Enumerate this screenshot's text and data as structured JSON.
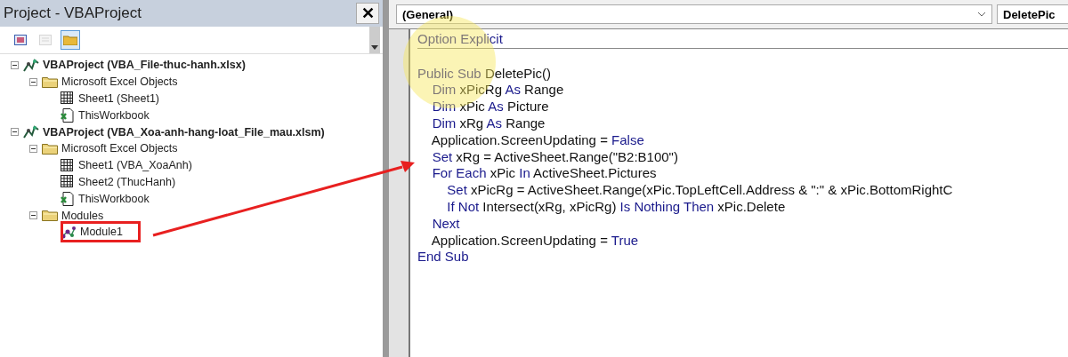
{
  "project_pane": {
    "title": "Project - VBAProject",
    "close": "✕",
    "toolbar": [
      {
        "kind": "view-object",
        "selected": false
      },
      {
        "kind": "view-code",
        "selected": false,
        "disabled": true
      },
      {
        "kind": "toggle-folders",
        "selected": true,
        "disabled": false
      }
    ],
    "tree": [
      {
        "label": "VBAProject (VBA_File-thuc-hanh.xlsx)",
        "kind": "project",
        "expanded": true,
        "highlighted": false,
        "children": [
          {
            "label": "Microsoft Excel Objects",
            "kind": "folder",
            "expanded": true,
            "highlighted": false,
            "children": [
              {
                "label": "Sheet1 (Sheet1)",
                "kind": "sheet",
                "highlighted": false
              },
              {
                "label": "ThisWorkbook",
                "kind": "workbook",
                "highlighted": false
              }
            ]
          }
        ]
      },
      {
        "label": "VBAProject (VBA_Xoa-anh-hang-loat_File_mau.xlsm)",
        "kind": "project",
        "expanded": true,
        "highlighted": false,
        "children": [
          {
            "label": "Microsoft Excel Objects",
            "kind": "folder",
            "expanded": true,
            "highlighted": false,
            "children": [
              {
                "label": "Sheet1 (VBA_XoaAnh)",
                "kind": "sheet",
                "highlighted": false
              },
              {
                "label": "Sheet2 (ThucHanh)",
                "kind": "sheet",
                "highlighted": false
              },
              {
                "label": "ThisWorkbook",
                "kind": "workbook",
                "highlighted": false
              }
            ]
          },
          {
            "label": "Modules",
            "kind": "folder",
            "expanded": true,
            "highlighted": false,
            "children": [
              {
                "label": "Module1",
                "kind": "module",
                "highlighted": true
              }
            ]
          }
        ]
      }
    ]
  },
  "code_window": {
    "object_combo": "(General)",
    "procedure_combo": "DeletePic",
    "declarations": [
      [
        {
          "text": "Option Explicit",
          "kind": "keyword"
        }
      ]
    ],
    "lines": [
      [
        {
          "text": "Public Sub",
          "kind": "keyword"
        },
        {
          "text": " DeletePic()",
          "kind": "plain"
        }
      ],
      [
        {
          "text": "    Dim",
          "kind": "keyword"
        },
        {
          "text": " xPicRg ",
          "kind": "plain"
        },
        {
          "text": "As",
          "kind": "keyword"
        },
        {
          "text": " Range",
          "kind": "plain"
        }
      ],
      [
        {
          "text": "    Dim",
          "kind": "keyword"
        },
        {
          "text": " xPic ",
          "kind": "plain"
        },
        {
          "text": "As",
          "kind": "keyword"
        },
        {
          "text": " Picture",
          "kind": "plain"
        }
      ],
      [
        {
          "text": "    Dim",
          "kind": "keyword"
        },
        {
          "text": " xRg ",
          "kind": "plain"
        },
        {
          "text": "As",
          "kind": "keyword"
        },
        {
          "text": " Range",
          "kind": "plain"
        }
      ],
      [
        {
          "text": "    Application.ScreenUpdating = ",
          "kind": "plain"
        },
        {
          "text": "False",
          "kind": "keyword"
        }
      ],
      [
        {
          "text": "    Set",
          "kind": "keyword"
        },
        {
          "text": " xRg = ActiveSheet.Range(\"B2:B100\")",
          "kind": "plain"
        }
      ],
      [
        {
          "text": "    For Each",
          "kind": "keyword"
        },
        {
          "text": " xPic ",
          "kind": "plain"
        },
        {
          "text": "In",
          "kind": "keyword"
        },
        {
          "text": " ActiveSheet.Pictures",
          "kind": "plain"
        }
      ],
      [
        {
          "text": "        Set",
          "kind": "keyword"
        },
        {
          "text": " xPicRg = ActiveSheet.Range(xPic.TopLeftCell.Address & \":\" & xPic.BottomRightC",
          "kind": "plain"
        }
      ],
      [
        {
          "text": "        If Not",
          "kind": "keyword"
        },
        {
          "text": " Intersect(xRg, xPicRg) ",
          "kind": "plain"
        },
        {
          "text": "Is Nothing Then",
          "kind": "keyword"
        },
        {
          "text": " xPic.Delete",
          "kind": "plain"
        }
      ],
      [
        {
          "text": "    Next",
          "kind": "keyword"
        }
      ],
      [
        {
          "text": "    Application.ScreenUpdating = ",
          "kind": "plain"
        },
        {
          "text": "True",
          "kind": "keyword"
        }
      ],
      [
        {
          "text": "End Sub",
          "kind": "keyword"
        }
      ]
    ]
  }
}
